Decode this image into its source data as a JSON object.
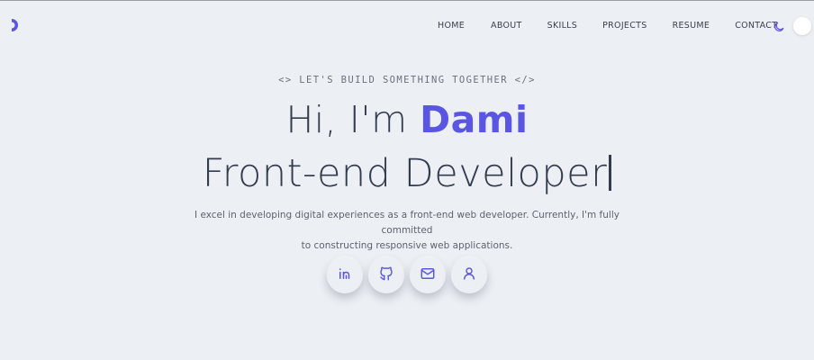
{
  "brand": {
    "logo_icon": "half-moon-logo-icon",
    "accent": "#5b55e3"
  },
  "nav": {
    "items": [
      {
        "label": "HOME"
      },
      {
        "label": "ABOUT"
      },
      {
        "label": "SKILLS"
      },
      {
        "label": "PROJECTS"
      },
      {
        "label": "RESUME"
      },
      {
        "label": "CONTACT"
      }
    ]
  },
  "theme": {
    "icon": "moon-icon",
    "toggle_color": "#ffffff"
  },
  "hero": {
    "tagline": "<> LET'S BUILD SOMETHING TOGETHER </>",
    "greeting": "Hi, I'm",
    "name": "Dami",
    "role": "Front-end Developer",
    "description_line1": "I excel in developing digital experiences as a front-end web developer. Currently, I'm fully committed",
    "description_line2": "to constructing responsive web applications."
  },
  "socials": [
    {
      "icon": "linkedin-icon"
    },
    {
      "icon": "github-icon"
    },
    {
      "icon": "mail-icon"
    },
    {
      "icon": "user-icon"
    }
  ],
  "colors": {
    "background": "#eceff4",
    "text": "#333c4e",
    "accent": "#5b55e3"
  }
}
